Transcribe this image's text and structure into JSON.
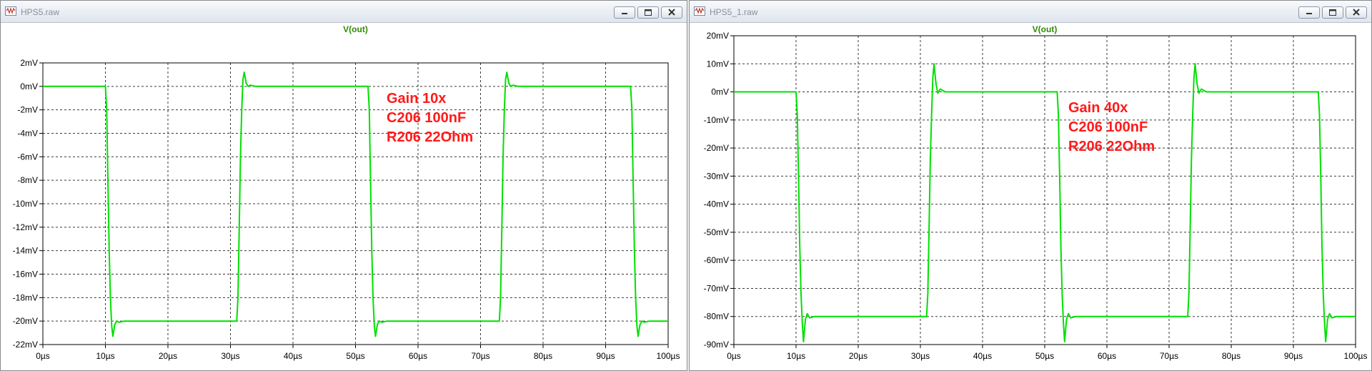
{
  "windows": [
    {
      "title": "HPS5.raw",
      "icons": {
        "app": "waveform-icon",
        "minimize": "minimize-icon",
        "maximize": "maximize-icon",
        "close": "close-icon"
      }
    },
    {
      "title": "HPS5_1.raw",
      "icons": {
        "app": "waveform-icon",
        "minimize": "minimize-icon",
        "maximize": "maximize-icon",
        "close": "close-icon"
      }
    }
  ],
  "chart_data": [
    {
      "type": "line",
      "title": "V(out)",
      "xlim": [
        0,
        100
      ],
      "ylim": [
        -22,
        2
      ],
      "xticks": [
        0,
        10,
        20,
        30,
        40,
        50,
        60,
        70,
        80,
        90,
        100
      ],
      "yticks": [
        2,
        0,
        -2,
        -4,
        -6,
        -8,
        -10,
        -12,
        -14,
        -16,
        -18,
        -20,
        -22
      ],
      "xtick_labels": [
        "0µs",
        "10µs",
        "20µs",
        "30µs",
        "40µs",
        "50µs",
        "60µs",
        "70µs",
        "80µs",
        "90µs",
        "100µs"
      ],
      "ytick_labels": [
        "2mV",
        "0mV",
        "-2mV",
        "-4mV",
        "-6mV",
        "-8mV",
        "-10mV",
        "-12mV",
        "-14mV",
        "-16mV",
        "-18mV",
        "-20mV",
        "-22mV"
      ],
      "grid": true,
      "line_color": "#00e000",
      "text_color": "#2e8b00",
      "annotation_color": "#ff1a1a",
      "annotations": [
        "Gain 10x",
        "C206 100nF",
        "R206 22Ohm"
      ],
      "series": [
        {
          "x": [
            0,
            10.0,
            10.2,
            10.4,
            10.6,
            10.8,
            11.0,
            11.2,
            11.5,
            11.8,
            12.2,
            13,
            31.0,
            31.2,
            31.4,
            31.6,
            31.8,
            32.0,
            32.2,
            32.5,
            32.8,
            33.2,
            34,
            52.0,
            52.2,
            52.4,
            52.6,
            52.8,
            53.0,
            53.2,
            53.5,
            53.8,
            54.2,
            55,
            73.0,
            73.2,
            73.4,
            73.6,
            73.8,
            74.0,
            74.2,
            74.5,
            74.8,
            75.2,
            76,
            94.0,
            94.2,
            94.4,
            94.6,
            94.8,
            95.0,
            95.2,
            95.5,
            95.8,
            96.2,
            97,
            100
          ],
          "y": [
            0,
            0,
            -2,
            -8,
            -14,
            -18,
            -20.4,
            -21.3,
            -20.3,
            -20.0,
            -20.1,
            -20,
            -20,
            -18,
            -12,
            -6,
            -2,
            0.6,
            1.2,
            0.3,
            0.0,
            0.1,
            0,
            0,
            -2,
            -8,
            -14,
            -18,
            -20.4,
            -21.3,
            -20.3,
            -20.0,
            -20.1,
            -20,
            -20,
            -18,
            -12,
            -6,
            -2,
            0.6,
            1.2,
            0.3,
            0.0,
            0.1,
            0,
            0,
            -2,
            -8,
            -14,
            -18,
            -20.4,
            -21.3,
            -20.3,
            -20.0,
            -20.1,
            -20,
            -20
          ]
        }
      ]
    },
    {
      "type": "line",
      "title": "V(out)",
      "xlim": [
        0,
        100
      ],
      "ylim": [
        -90,
        20
      ],
      "xticks": [
        0,
        10,
        20,
        30,
        40,
        50,
        60,
        70,
        80,
        90,
        100
      ],
      "yticks": [
        20,
        10,
        0,
        -10,
        -20,
        -30,
        -40,
        -50,
        -60,
        -70,
        -80,
        -90
      ],
      "xtick_labels": [
        "0µs",
        "10µs",
        "20µs",
        "30µs",
        "40µs",
        "50µs",
        "60µs",
        "70µs",
        "80µs",
        "90µs",
        "100µs"
      ],
      "ytick_labels": [
        "20mV",
        "10mV",
        "0mV",
        "-10mV",
        "-20mV",
        "-30mV",
        "-40mV",
        "-50mV",
        "-60mV",
        "-70mV",
        "-80mV",
        "-90mV"
      ],
      "grid": true,
      "line_color": "#00e000",
      "text_color": "#2e8b00",
      "annotation_color": "#ff1a1a",
      "annotations": [
        "Gain 40x",
        "C206 100nF",
        "R206 22Ohm"
      ],
      "series": [
        {
          "x": [
            0,
            10.0,
            10.2,
            10.4,
            10.6,
            10.8,
            11.0,
            11.2,
            11.5,
            11.8,
            12.2,
            13,
            31.0,
            31.2,
            31.4,
            31.6,
            31.8,
            32.0,
            32.2,
            32.5,
            32.8,
            33.2,
            34,
            52.0,
            52.2,
            52.4,
            52.6,
            52.8,
            53.0,
            53.2,
            53.5,
            53.8,
            54.2,
            55,
            73.0,
            73.2,
            73.4,
            73.6,
            73.8,
            74.0,
            74.2,
            74.5,
            74.8,
            75.2,
            76,
            94.0,
            94.2,
            94.4,
            94.6,
            94.8,
            95.0,
            95.2,
            95.5,
            95.8,
            96.2,
            97,
            100
          ],
          "y": [
            0,
            0,
            -8,
            -30,
            -55,
            -72,
            -82,
            -89,
            -81,
            -79,
            -80.5,
            -80,
            -80,
            -72,
            -48,
            -24,
            -8,
            5,
            10,
            3,
            -0.5,
            1,
            0,
            0,
            -8,
            -30,
            -55,
            -72,
            -82,
            -89,
            -81,
            -79,
            -80.5,
            -80,
            -80,
            -72,
            -48,
            -24,
            -8,
            5,
            10,
            3,
            -0.5,
            1,
            0,
            0,
            -8,
            -30,
            -55,
            -72,
            -82,
            -89,
            -81,
            -79,
            -80.5,
            -80,
            -80
          ]
        }
      ]
    }
  ]
}
